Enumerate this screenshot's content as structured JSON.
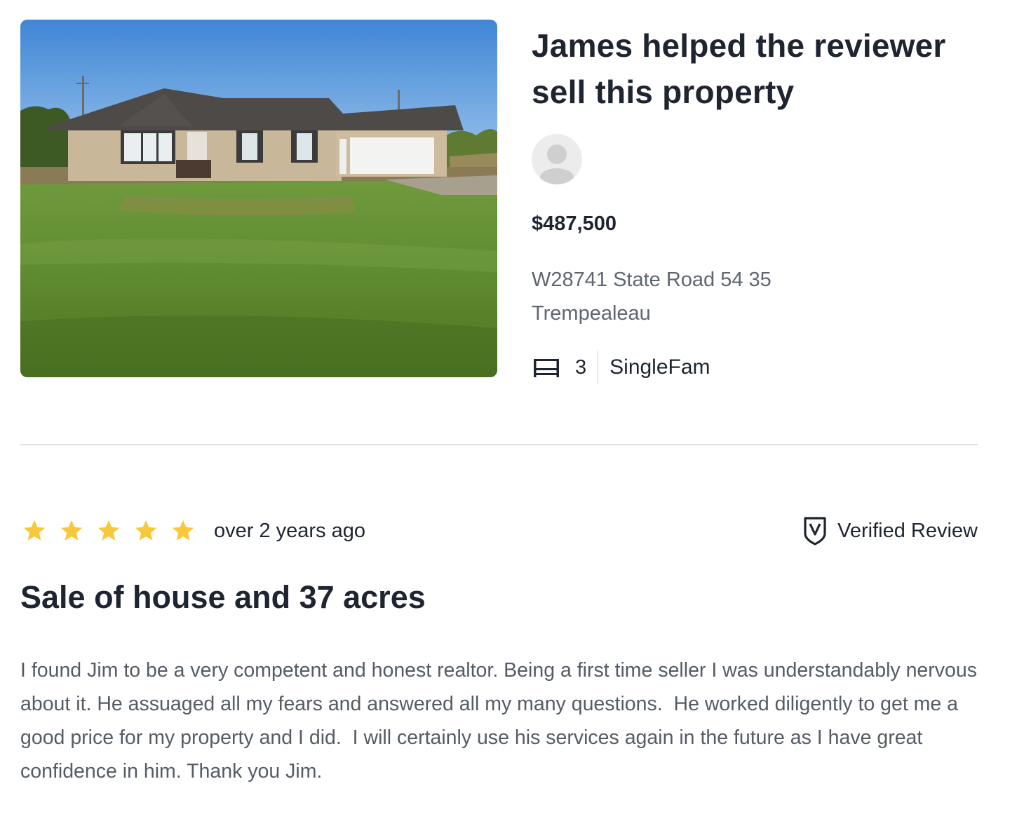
{
  "property": {
    "photo_alt": "Single-family ranch house with attached garage and large lawn",
    "headline": "James helped the reviewer sell this property",
    "price": "$487,500",
    "address_line1": "W28741 State Road 54 35",
    "address_line2": "Trempealeau",
    "beds": "3",
    "property_type": "SingleFam",
    "icons": {
      "bed": "bed-icon",
      "avatar": "avatar-placeholder"
    }
  },
  "review": {
    "rating": 5,
    "rating_max": 5,
    "star_color": "#f7c83c",
    "age": "over 2 years ago",
    "verified_label": "Verified Review",
    "title": "Sale of house and 37 acres",
    "body": "I found Jim to be a very competent and honest realtor. Being a first time seller I was understandably nervous about it. He assuaged all my fears and answered all my many questions.  He worked diligently to get me a good price for my property and I did.  I will certainly use his services again in the future as I have great confidence in him. Thank you Jim.",
    "icons": {
      "star": "star-icon",
      "verified": "shield-check-icon"
    }
  }
}
